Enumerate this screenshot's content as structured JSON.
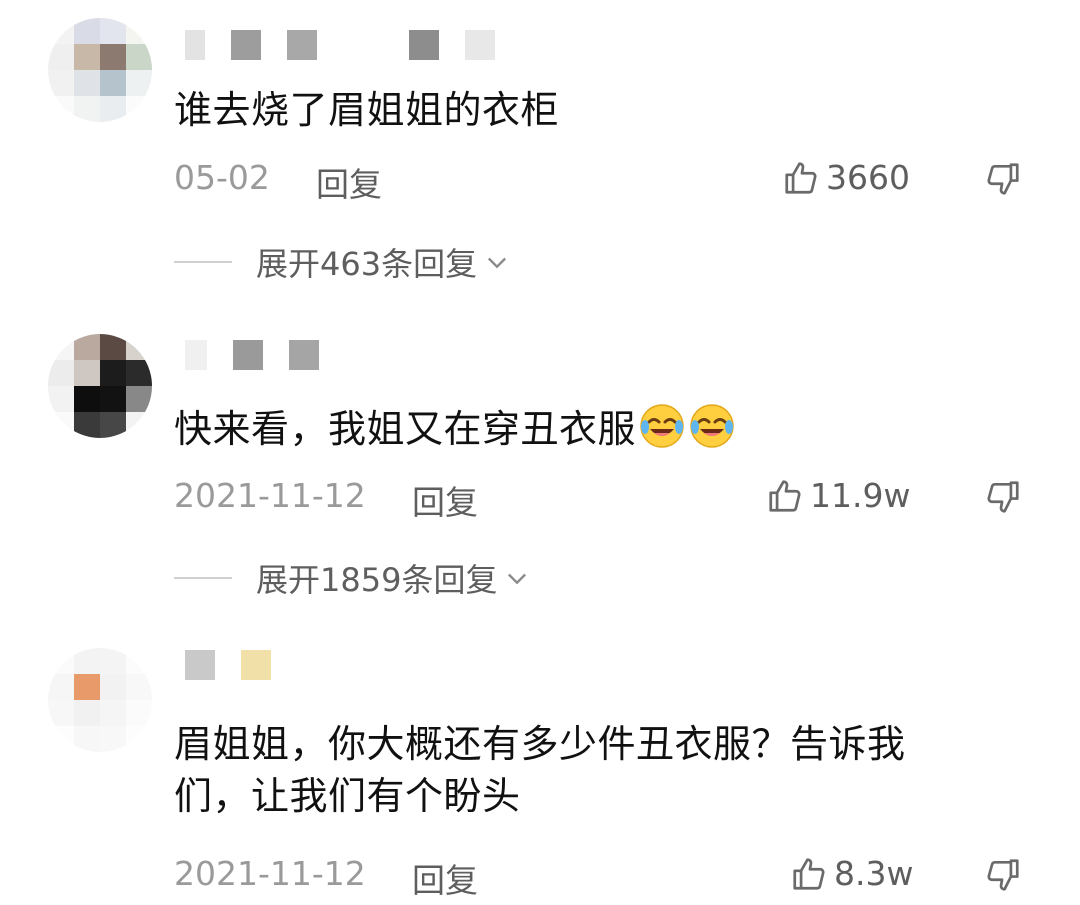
{
  "comments": [
    {
      "text": "谁去烧了眉姐姐的衣柜",
      "date": "05-02",
      "reply_label": "回复",
      "likes": "3660",
      "expand_label": "展开463条回复"
    },
    {
      "text": "快来看，我姐又在穿丑衣服",
      "emoji": [
        "laughing-crying-emoji",
        "laughing-crying-emoji"
      ],
      "date": "2021-11-12",
      "reply_label": "回复",
      "likes": "11.9w",
      "expand_label": "展开1859条回复"
    },
    {
      "text_line1": "眉姐姐，你大概还有多少件丑衣服？告诉我",
      "text_line2": "们，让我们有个盼头",
      "date": "2021-11-12",
      "reply_label": "回复",
      "likes": "8.3w"
    }
  ],
  "icons": {
    "like": "thumbs-up-icon",
    "dislike": "thumbs-down-icon",
    "expand": "chevron-down-icon"
  },
  "colors": {
    "text": "#111111",
    "meta": "#9a9a9a",
    "action": "#5e5e5e"
  }
}
